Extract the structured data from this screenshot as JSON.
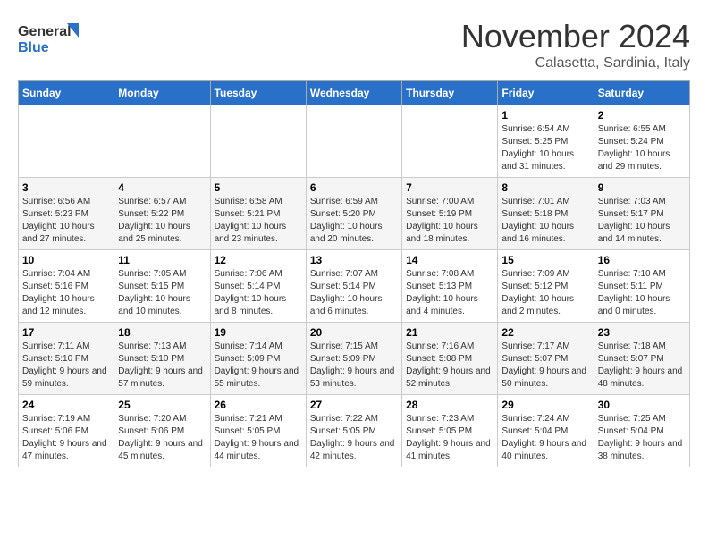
{
  "header": {
    "logo_line1": "General",
    "logo_line2": "Blue",
    "month": "November 2024",
    "location": "Calasetta, Sardinia, Italy"
  },
  "weekdays": [
    "Sunday",
    "Monday",
    "Tuesday",
    "Wednesday",
    "Thursday",
    "Friday",
    "Saturday"
  ],
  "weeks": [
    [
      {
        "day": "",
        "info": ""
      },
      {
        "day": "",
        "info": ""
      },
      {
        "day": "",
        "info": ""
      },
      {
        "day": "",
        "info": ""
      },
      {
        "day": "",
        "info": ""
      },
      {
        "day": "1",
        "info": "Sunrise: 6:54 AM\nSunset: 5:25 PM\nDaylight: 10 hours and 31 minutes."
      },
      {
        "day": "2",
        "info": "Sunrise: 6:55 AM\nSunset: 5:24 PM\nDaylight: 10 hours and 29 minutes."
      }
    ],
    [
      {
        "day": "3",
        "info": "Sunrise: 6:56 AM\nSunset: 5:23 PM\nDaylight: 10 hours and 27 minutes."
      },
      {
        "day": "4",
        "info": "Sunrise: 6:57 AM\nSunset: 5:22 PM\nDaylight: 10 hours and 25 minutes."
      },
      {
        "day": "5",
        "info": "Sunrise: 6:58 AM\nSunset: 5:21 PM\nDaylight: 10 hours and 23 minutes."
      },
      {
        "day": "6",
        "info": "Sunrise: 6:59 AM\nSunset: 5:20 PM\nDaylight: 10 hours and 20 minutes."
      },
      {
        "day": "7",
        "info": "Sunrise: 7:00 AM\nSunset: 5:19 PM\nDaylight: 10 hours and 18 minutes."
      },
      {
        "day": "8",
        "info": "Sunrise: 7:01 AM\nSunset: 5:18 PM\nDaylight: 10 hours and 16 minutes."
      },
      {
        "day": "9",
        "info": "Sunrise: 7:03 AM\nSunset: 5:17 PM\nDaylight: 10 hours and 14 minutes."
      }
    ],
    [
      {
        "day": "10",
        "info": "Sunrise: 7:04 AM\nSunset: 5:16 PM\nDaylight: 10 hours and 12 minutes."
      },
      {
        "day": "11",
        "info": "Sunrise: 7:05 AM\nSunset: 5:15 PM\nDaylight: 10 hours and 10 minutes."
      },
      {
        "day": "12",
        "info": "Sunrise: 7:06 AM\nSunset: 5:14 PM\nDaylight: 10 hours and 8 minutes."
      },
      {
        "day": "13",
        "info": "Sunrise: 7:07 AM\nSunset: 5:14 PM\nDaylight: 10 hours and 6 minutes."
      },
      {
        "day": "14",
        "info": "Sunrise: 7:08 AM\nSunset: 5:13 PM\nDaylight: 10 hours and 4 minutes."
      },
      {
        "day": "15",
        "info": "Sunrise: 7:09 AM\nSunset: 5:12 PM\nDaylight: 10 hours and 2 minutes."
      },
      {
        "day": "16",
        "info": "Sunrise: 7:10 AM\nSunset: 5:11 PM\nDaylight: 10 hours and 0 minutes."
      }
    ],
    [
      {
        "day": "17",
        "info": "Sunrise: 7:11 AM\nSunset: 5:10 PM\nDaylight: 9 hours and 59 minutes."
      },
      {
        "day": "18",
        "info": "Sunrise: 7:13 AM\nSunset: 5:10 PM\nDaylight: 9 hours and 57 minutes."
      },
      {
        "day": "19",
        "info": "Sunrise: 7:14 AM\nSunset: 5:09 PM\nDaylight: 9 hours and 55 minutes."
      },
      {
        "day": "20",
        "info": "Sunrise: 7:15 AM\nSunset: 5:09 PM\nDaylight: 9 hours and 53 minutes."
      },
      {
        "day": "21",
        "info": "Sunrise: 7:16 AM\nSunset: 5:08 PM\nDaylight: 9 hours and 52 minutes."
      },
      {
        "day": "22",
        "info": "Sunrise: 7:17 AM\nSunset: 5:07 PM\nDaylight: 9 hours and 50 minutes."
      },
      {
        "day": "23",
        "info": "Sunrise: 7:18 AM\nSunset: 5:07 PM\nDaylight: 9 hours and 48 minutes."
      }
    ],
    [
      {
        "day": "24",
        "info": "Sunrise: 7:19 AM\nSunset: 5:06 PM\nDaylight: 9 hours and 47 minutes."
      },
      {
        "day": "25",
        "info": "Sunrise: 7:20 AM\nSunset: 5:06 PM\nDaylight: 9 hours and 45 minutes."
      },
      {
        "day": "26",
        "info": "Sunrise: 7:21 AM\nSunset: 5:05 PM\nDaylight: 9 hours and 44 minutes."
      },
      {
        "day": "27",
        "info": "Sunrise: 7:22 AM\nSunset: 5:05 PM\nDaylight: 9 hours and 42 minutes."
      },
      {
        "day": "28",
        "info": "Sunrise: 7:23 AM\nSunset: 5:05 PM\nDaylight: 9 hours and 41 minutes."
      },
      {
        "day": "29",
        "info": "Sunrise: 7:24 AM\nSunset: 5:04 PM\nDaylight: 9 hours and 40 minutes."
      },
      {
        "day": "30",
        "info": "Sunrise: 7:25 AM\nSunset: 5:04 PM\nDaylight: 9 hours and 38 minutes."
      }
    ]
  ]
}
